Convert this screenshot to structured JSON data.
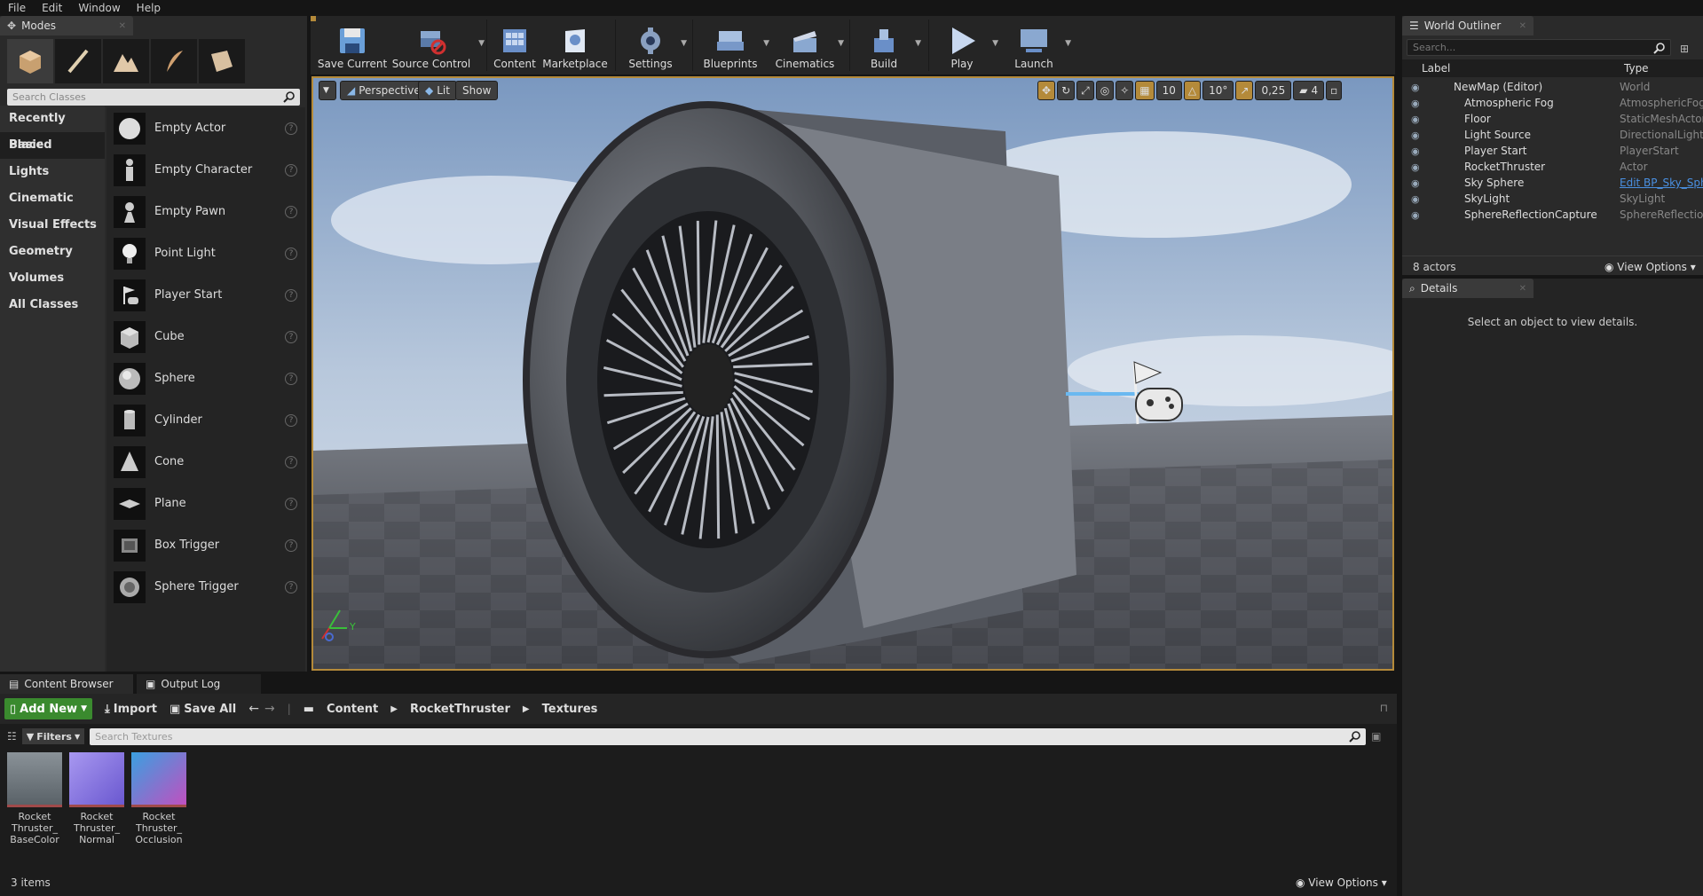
{
  "menu": [
    "File",
    "Edit",
    "Window",
    "Help"
  ],
  "modes": {
    "tab_label": "Modes",
    "search_placeholder": "Search Classes",
    "categories": [
      "Recently Placed",
      "Basic",
      "Lights",
      "Cinematic",
      "Visual Effects",
      "Geometry",
      "Volumes",
      "All Classes"
    ],
    "selected_category": "Basic",
    "items": [
      "Empty Actor",
      "Empty Character",
      "Empty Pawn",
      "Point Light",
      "Player Start",
      "Cube",
      "Sphere",
      "Cylinder",
      "Cone",
      "Plane",
      "Box Trigger",
      "Sphere Trigger"
    ]
  },
  "toolbar": {
    "buttons": [
      {
        "label": "Save Current",
        "icon": "save-icon"
      },
      {
        "label": "Source Control",
        "icon": "source-control-icon"
      },
      {
        "label": "Content",
        "icon": "content-icon"
      },
      {
        "label": "Marketplace",
        "icon": "marketplace-icon"
      },
      {
        "label": "Settings",
        "icon": "settings-icon"
      },
      {
        "label": "Blueprints",
        "icon": "blueprints-icon"
      },
      {
        "label": "Cinematics",
        "icon": "cinematics-icon"
      },
      {
        "label": "Build",
        "icon": "build-icon"
      },
      {
        "label": "Play",
        "icon": "play-icon"
      },
      {
        "label": "Launch",
        "icon": "launch-icon"
      }
    ]
  },
  "viewport": {
    "perspective_label": "Perspective",
    "lit_label": "Lit",
    "show_label": "Show",
    "grid_snap": "10",
    "rotation_snap": "10°",
    "scale_snap": "0,25",
    "camera_speed": "4",
    "axis_y": "Y"
  },
  "outliner": {
    "tab_label": "World Outliner",
    "search_placeholder": "Search...",
    "col_label": "Label",
    "col_type": "Type",
    "rows": [
      {
        "label": "NewMap (Editor)",
        "type": "World"
      },
      {
        "label": "Atmospheric Fog",
        "type": "AtmosphericFog"
      },
      {
        "label": "Floor",
        "type": "StaticMeshActor"
      },
      {
        "label": "Light Source",
        "type": "DirectionalLight"
      },
      {
        "label": "Player Start",
        "type": "PlayerStart"
      },
      {
        "label": "RocketThruster",
        "type": "Actor"
      },
      {
        "label": "Sky Sphere",
        "type": "Edit BP_Sky_Sphere"
      },
      {
        "label": "SkyLight",
        "type": "SkyLight"
      },
      {
        "label": "SphereReflectionCapture",
        "type": "SphereReflectionCapture"
      }
    ],
    "count": "8 actors",
    "view_options": "View Options"
  },
  "details": {
    "tab_label": "Details",
    "empty_text": "Select an object to view details."
  },
  "content_browser": {
    "tab_label": "Content Browser",
    "output_log_label": "Output Log",
    "add_new": "Add New",
    "import": "Import",
    "save_all": "Save All",
    "path": [
      "Content",
      "RocketThruster",
      "Textures"
    ],
    "filters": "Filters",
    "search_placeholder": "Search Textures",
    "assets": [
      {
        "name": "Rocket Thruster_ BaseColor",
        "color": "#6f7a80"
      },
      {
        "name": "Rocket Thruster_ Normal",
        "color": "#8d7be0"
      },
      {
        "name": "Rocket Thruster_ Occlusion",
        "color": "#4aa0d0"
      }
    ],
    "count": "3 items",
    "view_options": "View Options"
  },
  "colors": {
    "accent": "#b48a3a",
    "add_new": "#3a8a2e",
    "link": "#4a90e2"
  }
}
